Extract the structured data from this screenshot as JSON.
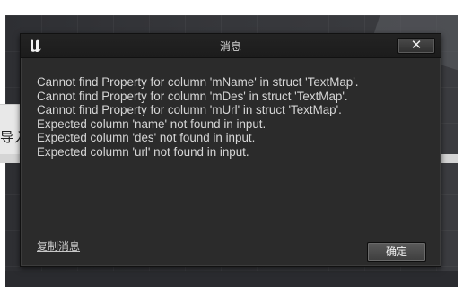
{
  "dialog": {
    "title": "消息",
    "close_label": "✕",
    "messages": [
      "Cannot find Property for column 'mName' in struct 'TextMap'.",
      "Cannot find Property for column 'mDes' in struct 'TextMap'.",
      "Cannot find Property for column 'mUrl' in struct 'TextMap'.",
      "Expected column 'name' not found in input.",
      "Expected column 'des' not found in input.",
      "Expected column 'url' not found in input."
    ],
    "copy_message_label": "复制消息",
    "ok_label": "确定"
  },
  "background": {
    "partial_text": "导入"
  },
  "icons": {
    "app_logo": "unreal-engine-logo-icon",
    "close": "close-icon",
    "cursor": "cursor-icon"
  }
}
